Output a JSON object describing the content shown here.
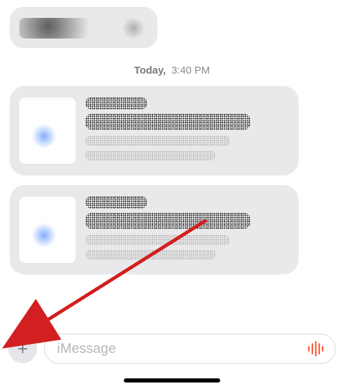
{
  "timestamp": {
    "day": "Today,",
    "time": "3:40 PM"
  },
  "composer": {
    "placeholder": "iMessage",
    "plus_label": "+"
  },
  "icons": {
    "plus": "plus-icon",
    "voice": "audio-waveform-icon"
  },
  "annotation": {
    "arrow_color": "#d21f1f"
  }
}
